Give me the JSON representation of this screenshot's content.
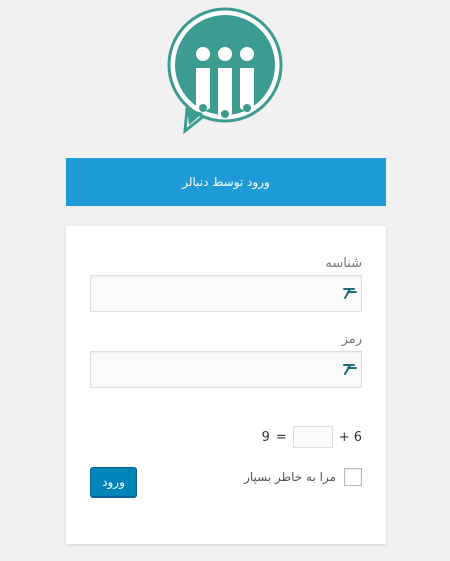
{
  "logo": {
    "icon": "chat-people-logo-icon",
    "color": "#3d9c92"
  },
  "social_login": {
    "label": "ورود توسط دنبالر",
    "color": "#1e9ad6"
  },
  "form": {
    "username": {
      "label": "شناسه",
      "value": ""
    },
    "password": {
      "label": "رمز",
      "value": ""
    },
    "captcha": {
      "left_operand": "6",
      "operator": "+",
      "equals": "=",
      "result": "9",
      "value": ""
    },
    "remember": {
      "label": "مرا به خاطر بسپار",
      "checked": false
    },
    "submit_label": "ورود",
    "accent_color": "#0085ba"
  }
}
